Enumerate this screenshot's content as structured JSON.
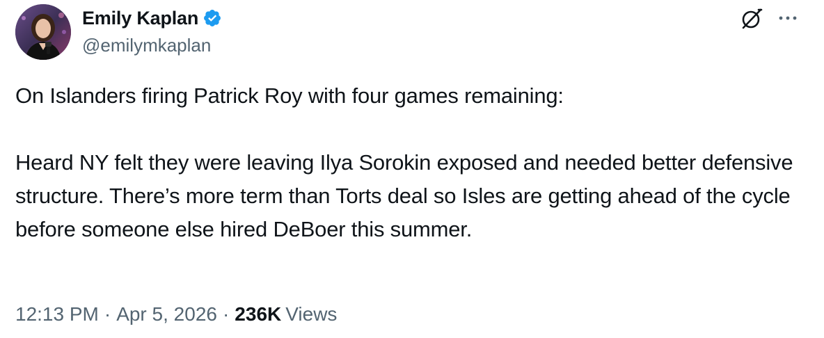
{
  "author": {
    "display_name": "Emily Kaplan",
    "handle": "@emilymkaplan",
    "verified": true
  },
  "tweet": {
    "text": "On Islanders firing Patrick Roy with four games remaining:\n\nHeard NY felt they were leaving Ilya Sorokin exposed and needed better defensive structure. There’s more term than Torts deal so Isles are getting ahead of the cycle before someone else hired DeBoer this summer."
  },
  "meta": {
    "time": "12:13 PM",
    "separator": "·",
    "date": "Apr 5, 2026",
    "views_count": "236K",
    "views_label": "Views"
  },
  "icons": {
    "verified": "verified-badge-icon",
    "grok": "grok-icon",
    "more": "more-horizontal-icon"
  },
  "colors": {
    "text_primary": "#0f1419",
    "text_secondary": "#536471",
    "verified_blue": "#1d9bf0"
  }
}
